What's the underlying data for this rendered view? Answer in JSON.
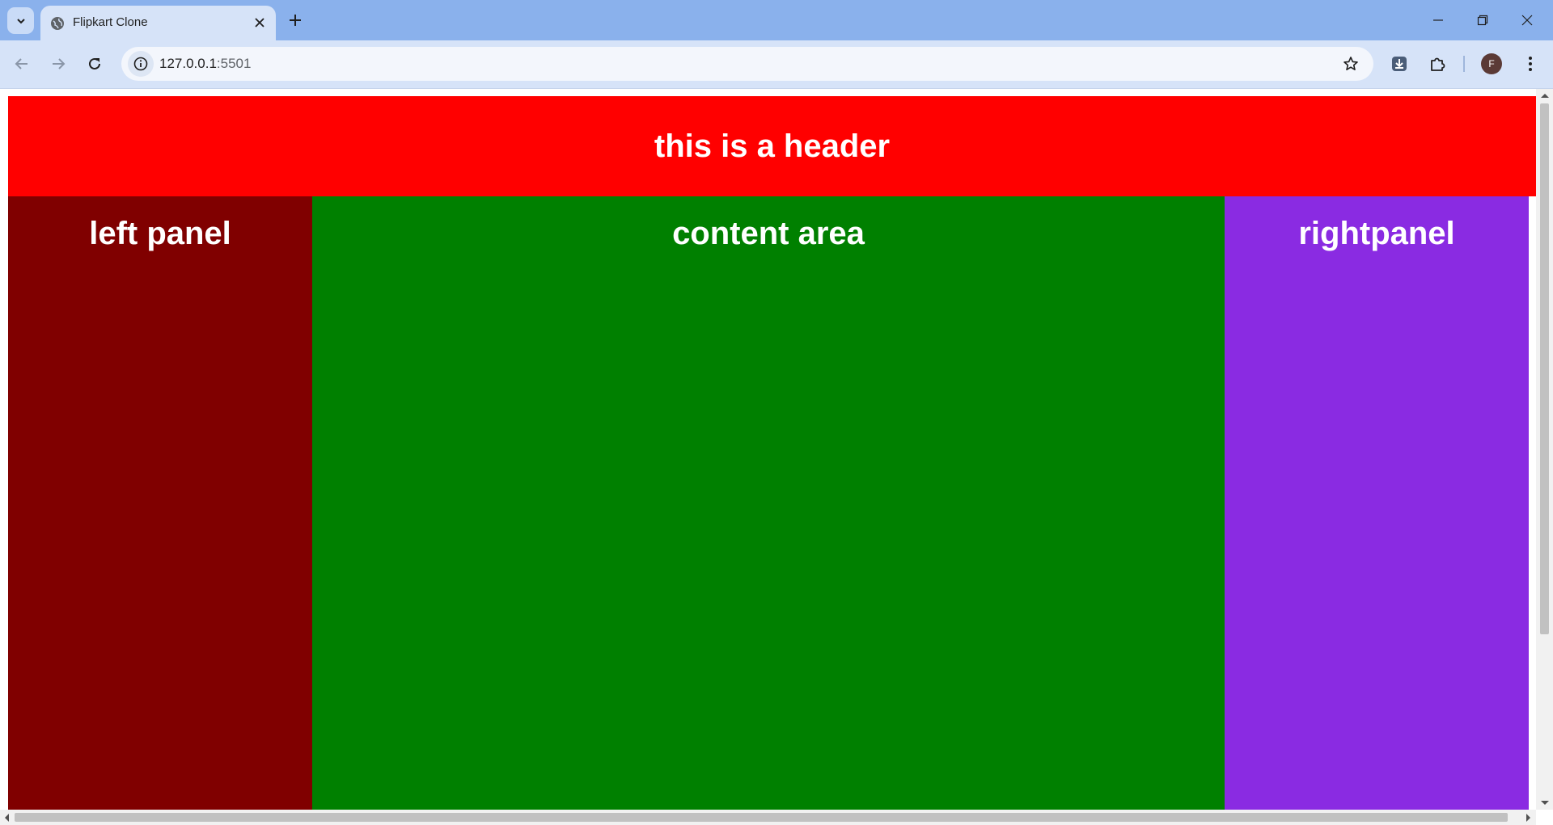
{
  "browser": {
    "tab_title": "Flipkart Clone",
    "url_host": "127.0.0.1",
    "url_port": ":5501",
    "profile_initial": "F"
  },
  "page": {
    "header_text": "this is a header",
    "left_panel_text": "left panel",
    "content_area_text": "content area",
    "right_panel_text": "rightpanel"
  },
  "colors": {
    "header": "#ff0000",
    "left_panel": "#800000",
    "content_area": "#008000",
    "right_panel": "#8a2be2"
  },
  "icons": [
    "tab-search-icon",
    "globe-icon",
    "close-icon",
    "plus-icon",
    "minimize-icon",
    "restore-icon",
    "window-close-icon",
    "back-icon",
    "forward-icon",
    "reload-icon",
    "site-info-icon",
    "star-icon",
    "download-icon",
    "extensions-icon",
    "more-icon"
  ]
}
